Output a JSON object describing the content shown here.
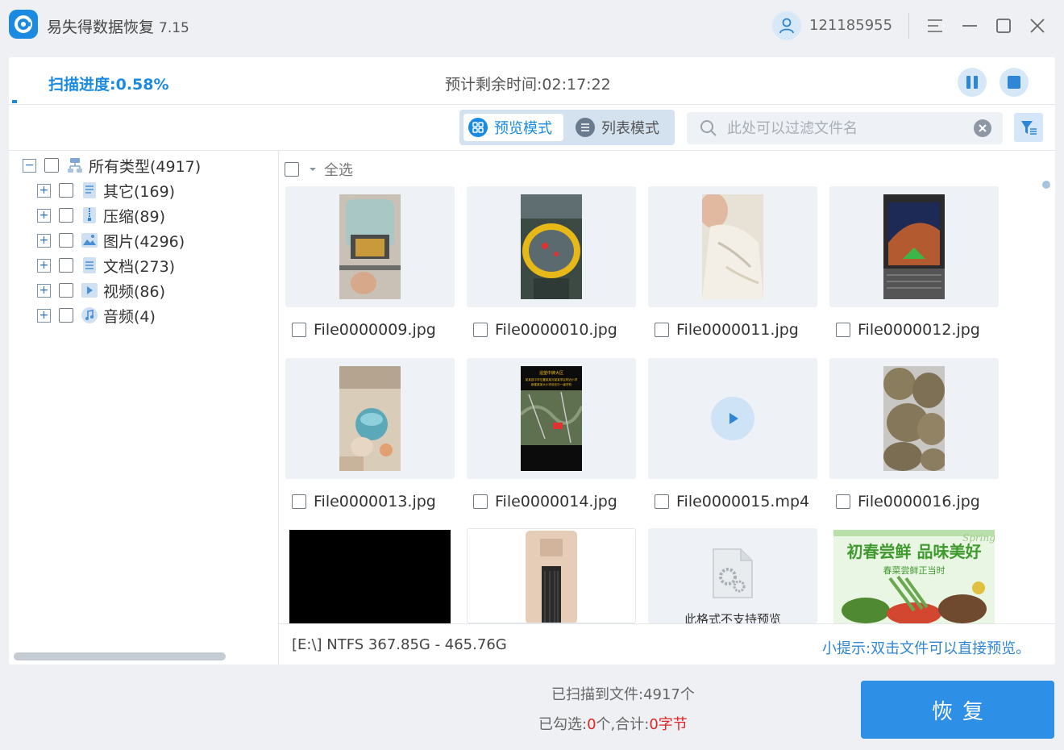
{
  "app": {
    "title": "易失得数据恢复",
    "version": "7.15"
  },
  "user": {
    "id": "121185955"
  },
  "scan": {
    "label": "扫描进度:",
    "percent": "0.58%",
    "progress_fraction": 0.0058,
    "remaining_label": "预计剩余时间:",
    "remaining": "02:17:22"
  },
  "modes": {
    "preview": "预览模式",
    "list": "列表模式",
    "active": "preview"
  },
  "search": {
    "placeholder": "此处可以过滤文件名",
    "value": ""
  },
  "tree": {
    "root": {
      "label": "所有类型(4917)"
    },
    "items": [
      {
        "label": "其它(169)",
        "icon": "other-icon"
      },
      {
        "label": "压缩(89)",
        "icon": "archive-icon"
      },
      {
        "label": "图片(4296)",
        "icon": "image-icon"
      },
      {
        "label": "文档(273)",
        "icon": "document-icon"
      },
      {
        "label": "视频(86)",
        "icon": "video-icon"
      },
      {
        "label": "音频(4)",
        "icon": "audio-icon"
      }
    ]
  },
  "grid": {
    "select_all": "全选",
    "files": [
      {
        "name": "File0000009.jpg"
      },
      {
        "name": "File0000010.jpg"
      },
      {
        "name": "File0000011.jpg"
      },
      {
        "name": "File0000012.jpg"
      },
      {
        "name": "File0000013.jpg"
      },
      {
        "name": "File0000014.jpg"
      },
      {
        "name": "File0000015.mp4"
      },
      {
        "name": "File0000016.jpg"
      }
    ],
    "partial_row": {
      "unsupported_text": "此格式不支持预览",
      "banner_script": "Spring",
      "banner_title": "初春尝鲜 品味美好",
      "banner_sub": "春菜尝鲜正当时",
      "poster_text_1": "遥望中牌大区",
      "poster_text_2": "某某县中学位置某某河某某学区附近小学",
      "poster_text_3": "新建某某大小学设在中一级学校"
    }
  },
  "status": {
    "drive": "[E:\\] NTFS 367.85G - 465.76G",
    "tip": "小提示:双击文件可以直接预览。"
  },
  "footer": {
    "scanned_label": "已扫描到文件:",
    "scanned_count": "4917",
    "scanned_unit": "个",
    "selected_label": "已勾选:",
    "selected_count": "0",
    "selected_unit": "个,合计:",
    "total_size": "0字节",
    "recover": "恢复"
  },
  "colors": {
    "accent": "#1a8be0",
    "button": "#2d8fe6",
    "highlight": "#e02424"
  }
}
